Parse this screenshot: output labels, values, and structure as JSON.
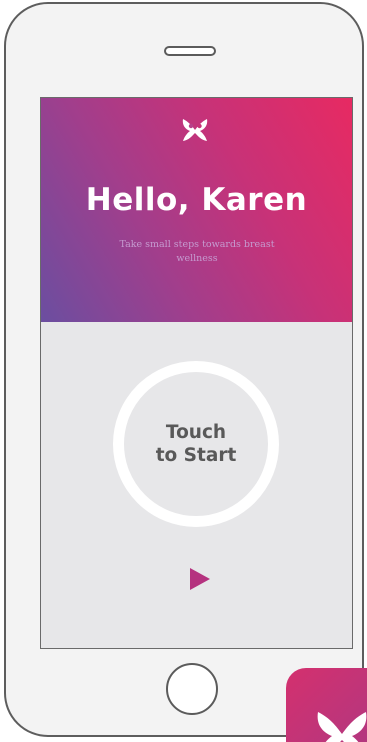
{
  "hero": {
    "greeting": "Hello, Karen",
    "tagline": "Take small steps towards breast wellness",
    "logo_icon": "bow-logo-icon",
    "gradient_colors": [
      "#6b4ea0",
      "#c73278",
      "#e72a62"
    ]
  },
  "start": {
    "label": "Touch\nto Start",
    "play_icon": "play-icon",
    "accent": "#b5327f"
  },
  "colors": {
    "screen_bg": "#e7e7e9",
    "ring": "#ffffff",
    "text": "#595959",
    "device_outline": "#5d5d5d"
  },
  "decor": {
    "badge_icon": "bow-logo-icon"
  }
}
